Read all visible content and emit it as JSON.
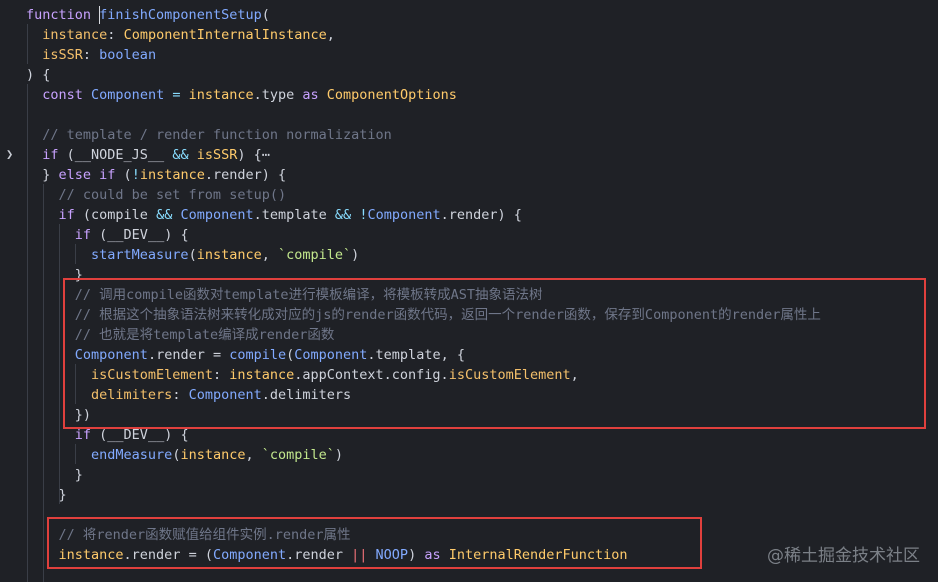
{
  "editor": {
    "fold_icon": "chevron-right-icon",
    "lines": [
      [
        {
          "t": "function ",
          "c": "kw"
        },
        {
          "t": "finishComponentSetup",
          "c": "fn"
        },
        {
          "t": "(",
          "c": "pl"
        }
      ],
      [
        {
          "t": "  ",
          "c": "pl"
        },
        {
          "t": "instance",
          "c": "pr"
        },
        {
          "t": ": ",
          "c": "pl"
        },
        {
          "t": "ComponentInternalInstance",
          "c": "ty"
        },
        {
          "t": ",",
          "c": "pl"
        }
      ],
      [
        {
          "t": "  ",
          "c": "pl"
        },
        {
          "t": "isSSR",
          "c": "pr"
        },
        {
          "t": ": ",
          "c": "pl"
        },
        {
          "t": "boolean",
          "c": "fn"
        }
      ],
      [
        {
          "t": ") {",
          "c": "pl"
        }
      ],
      [
        {
          "t": "  ",
          "c": "pl"
        },
        {
          "t": "const ",
          "c": "kw"
        },
        {
          "t": "Component",
          "c": "cn"
        },
        {
          "t": " = ",
          "c": "op"
        },
        {
          "t": "instance",
          "c": "vr"
        },
        {
          "t": ".type ",
          "c": "pl"
        },
        {
          "t": "as ",
          "c": "kw"
        },
        {
          "t": "ComponentOptions",
          "c": "ty"
        }
      ],
      [],
      [
        {
          "t": "  // template / render function normalization",
          "c": "cm"
        }
      ],
      [
        {
          "t": "  ",
          "c": "pl"
        },
        {
          "t": "if ",
          "c": "kw"
        },
        {
          "t": "(__NODE_JS__ ",
          "c": "pl"
        },
        {
          "t": "&&",
          "c": "op"
        },
        {
          "t": " ",
          "c": "pl"
        },
        {
          "t": "isSSR",
          "c": "vr"
        },
        {
          "t": ") {",
          "c": "pl"
        },
        {
          "t": "⋯",
          "c": "pl"
        }
      ],
      [
        {
          "t": "  } ",
          "c": "pl"
        },
        {
          "t": "else if ",
          "c": "kw"
        },
        {
          "t": "(",
          "c": "pl"
        },
        {
          "t": "!",
          "c": "op"
        },
        {
          "t": "instance",
          "c": "vr"
        },
        {
          "t": ".render) {",
          "c": "pl"
        }
      ],
      [
        {
          "t": "    // could be set from setup()",
          "c": "cm"
        }
      ],
      [
        {
          "t": "    ",
          "c": "pl"
        },
        {
          "t": "if ",
          "c": "kw"
        },
        {
          "t": "(compile ",
          "c": "pl"
        },
        {
          "t": "&&",
          "c": "op"
        },
        {
          "t": " ",
          "c": "pl"
        },
        {
          "t": "Component",
          "c": "cn"
        },
        {
          "t": ".template ",
          "c": "pl"
        },
        {
          "t": "&&",
          "c": "op"
        },
        {
          "t": " ",
          "c": "pl"
        },
        {
          "t": "!",
          "c": "op"
        },
        {
          "t": "Component",
          "c": "cn"
        },
        {
          "t": ".render) {",
          "c": "pl"
        }
      ],
      [
        {
          "t": "      ",
          "c": "pl"
        },
        {
          "t": "if ",
          "c": "kw"
        },
        {
          "t": "(__DEV__) {",
          "c": "pl"
        }
      ],
      [
        {
          "t": "        ",
          "c": "pl"
        },
        {
          "t": "startMeasure",
          "c": "fn"
        },
        {
          "t": "(",
          "c": "pl"
        },
        {
          "t": "instance",
          "c": "vr"
        },
        {
          "t": ", ",
          "c": "pl"
        },
        {
          "t": "`compile`",
          "c": "st"
        },
        {
          "t": ")",
          "c": "pl"
        }
      ],
      [
        {
          "t": "      }",
          "c": "pl"
        }
      ],
      [
        {
          "t": "      // 调用compile函数对template进行模板编译，将模板转成AST抽象语法树",
          "c": "cm"
        }
      ],
      [
        {
          "t": "      // 根据这个抽象语法树来转化成对应的js的render函数代码，返回一个render函数，保存到Component的render属性上",
          "c": "cm"
        }
      ],
      [
        {
          "t": "      // 也就是将template编译成render函数",
          "c": "cm"
        }
      ],
      [
        {
          "t": "      ",
          "c": "pl"
        },
        {
          "t": "Component",
          "c": "cn"
        },
        {
          "t": ".render = ",
          "c": "pl"
        },
        {
          "t": "compile",
          "c": "fn"
        },
        {
          "t": "(",
          "c": "pl"
        },
        {
          "t": "Component",
          "c": "cn"
        },
        {
          "t": ".template, {",
          "c": "pl"
        }
      ],
      [
        {
          "t": "        ",
          "c": "pl"
        },
        {
          "t": "isCustomElement",
          "c": "pr"
        },
        {
          "t": ": ",
          "c": "pl"
        },
        {
          "t": "instance",
          "c": "vr"
        },
        {
          "t": ".appContext.config.",
          "c": "pl"
        },
        {
          "t": "isCustomElement",
          "c": "pr"
        },
        {
          "t": ",",
          "c": "pl"
        }
      ],
      [
        {
          "t": "        ",
          "c": "pl"
        },
        {
          "t": "delimiters",
          "c": "pr"
        },
        {
          "t": ": ",
          "c": "pl"
        },
        {
          "t": "Component",
          "c": "cn"
        },
        {
          "t": ".delimiters",
          "c": "pl"
        }
      ],
      [
        {
          "t": "      })",
          "c": "pl"
        }
      ],
      [
        {
          "t": "      ",
          "c": "pl"
        },
        {
          "t": "if ",
          "c": "kw"
        },
        {
          "t": "(__DEV__) {",
          "c": "pl"
        }
      ],
      [
        {
          "t": "        ",
          "c": "pl"
        },
        {
          "t": "endMeasure",
          "c": "fn"
        },
        {
          "t": "(",
          "c": "pl"
        },
        {
          "t": "instance",
          "c": "vr"
        },
        {
          "t": ", ",
          "c": "pl"
        },
        {
          "t": "`compile`",
          "c": "st"
        },
        {
          "t": ")",
          "c": "pl"
        }
      ],
      [
        {
          "t": "      }",
          "c": "pl"
        }
      ],
      [
        {
          "t": "    }",
          "c": "pl"
        }
      ],
      [],
      [
        {
          "t": "    // 将render函数赋值给组件实例.render属性",
          "c": "cm"
        }
      ],
      [
        {
          "t": "    ",
          "c": "pl"
        },
        {
          "t": "instance",
          "c": "vr"
        },
        {
          "t": ".render = (",
          "c": "pl"
        },
        {
          "t": "Component",
          "c": "cn"
        },
        {
          "t": ".render ",
          "c": "pl"
        },
        {
          "t": "||",
          "c": "kw2"
        },
        {
          "t": " ",
          "c": "pl"
        },
        {
          "t": "NOOP",
          "c": "fn"
        },
        {
          "t": ") ",
          "c": "pl"
        },
        {
          "t": "as ",
          "c": "kw"
        },
        {
          "t": "InternalRenderFunction",
          "c": "ty"
        }
      ]
    ]
  },
  "highlight_color": "#e0403d",
  "watermark": "@稀土掘金技术社区"
}
